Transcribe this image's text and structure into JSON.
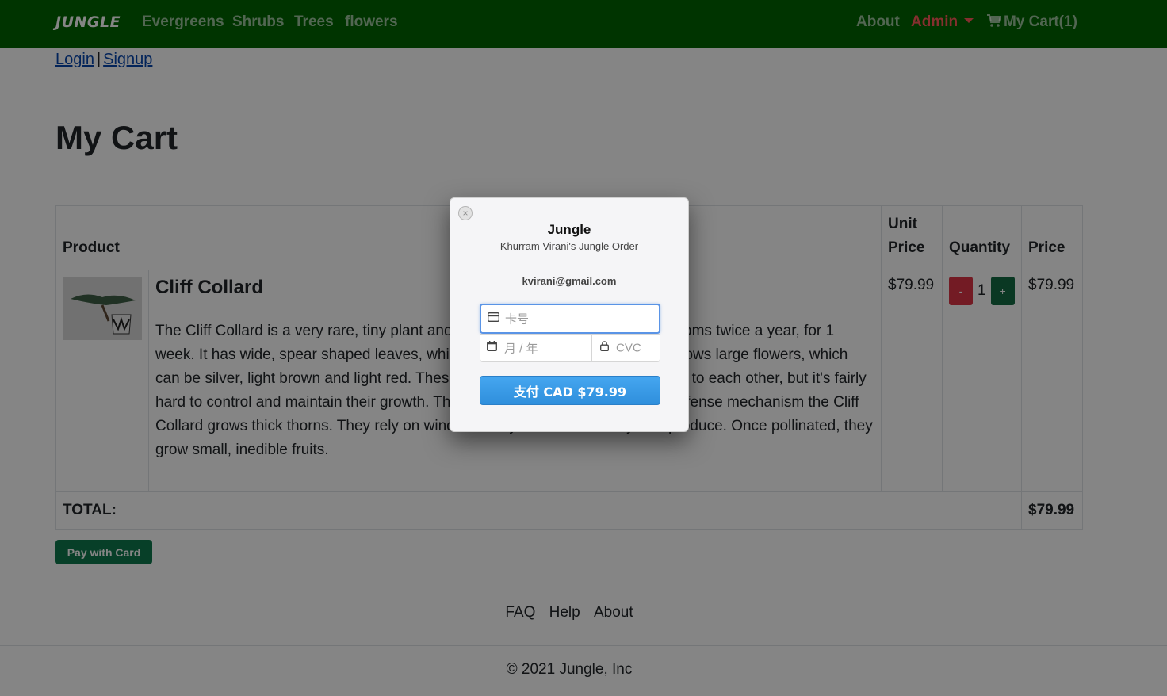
{
  "navbar": {
    "brand": "JUNGLE",
    "left_links": [
      "Evergreens",
      "Shrubs",
      "Trees",
      "flowers"
    ],
    "about": "About",
    "admin": "Admin",
    "cart": "My Cart(1)"
  },
  "auth": {
    "login": "Login",
    "separator": "|",
    "signup": "Signup"
  },
  "page_title": "My Cart",
  "table": {
    "headers": {
      "product": "Product",
      "unit_price": "Unit Price",
      "quantity": "Quantity",
      "price": "Price"
    },
    "item": {
      "name": "Cliff Collard",
      "description": "The Cliff Collard is a very rare, tiny plant and is related to the sunflower. It blossoms twice a year, for 1 week. It has wide, spear shaped leaves, which are usually dark green. It also grows large flowers, which can be silver, light brown and light red. These plants grow in small groups, close to each other, but it's fairly hard to control and maintain their growth. They can keep pests away by their defense mechanism the Cliff Collard grows thick thorns. They rely on winds to carry their seeds away to reproduce. Once pollinated, they grow small, inedible fruits.",
      "unit_price": "$79.99",
      "quantity": "1",
      "minus_label": "-",
      "plus_label": "+",
      "price": "$79.99"
    },
    "total_label": "TOTAL:",
    "total_value": "$79.99"
  },
  "pay_button": "Pay with Card",
  "footer": {
    "links": [
      "FAQ",
      "Help",
      "About"
    ],
    "copyright": "© 2021 Jungle, Inc"
  },
  "checkout_modal": {
    "close": "×",
    "title": "Jungle",
    "subtitle": "Khurram Virani's Jungle Order",
    "email": "kvirani@gmail.com",
    "card_placeholder": "卡号",
    "expiry_placeholder": "月 / 年",
    "cvc_placeholder": "CVC",
    "submit_label": "支付 CAD $79.99"
  },
  "colors": {
    "navbar": "#006400",
    "admin": "#ff5a5a",
    "minus_button": "#dc3545",
    "plus_button": "#146c43",
    "pay_button": "#0f7a4d",
    "submit_button": "#3a9be6"
  },
  "icons": [
    "cart-icon",
    "close-icon",
    "credit-card-icon",
    "calendar-icon",
    "lock-icon"
  ]
}
